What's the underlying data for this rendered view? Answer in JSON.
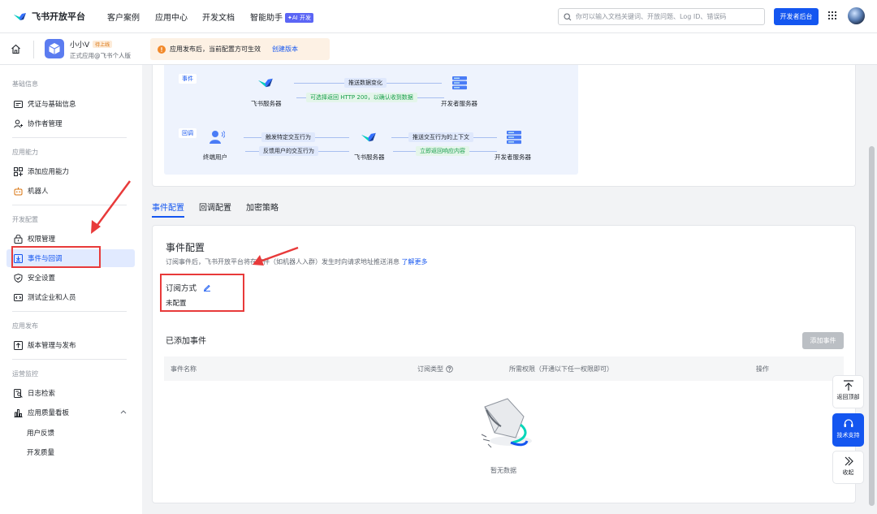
{
  "topnav": {
    "logo_text": "飞书开放平台",
    "links": [
      "客户案例",
      "应用中心",
      "开发文档",
      "智能助手"
    ],
    "ai_badge": "✦AI 开发",
    "search_placeholder": "你可以输入文档关键词、开放问题、Log ID、错误码",
    "dev_console_label": "开发者后台"
  },
  "appbar": {
    "app_name": "小小V",
    "status_badge": "待上线",
    "app_subtitle": "正式应用@飞书个人版",
    "notice_text": "应用发布后，当前配置方可生效",
    "notice_link": "创建版本"
  },
  "sidebar": {
    "groups": [
      {
        "title": "基础信息",
        "items": [
          "凭证与基础信息",
          "协作者管理"
        ]
      },
      {
        "title": "应用能力",
        "items": [
          "添加应用能力",
          "机器人"
        ]
      },
      {
        "title": "开发配置",
        "items": [
          "权限管理",
          "事件与回调",
          "安全设置",
          "测试企业和人员"
        ]
      },
      {
        "title": "应用发布",
        "items": [
          "版本管理与发布"
        ]
      },
      {
        "title": "运营监控",
        "items": [
          "日志检索",
          "应用质量看板"
        ]
      }
    ],
    "quality_sub_items": [
      "用户反馈",
      "开发质量"
    ],
    "active_item": "事件与回调"
  },
  "flow": {
    "event_tag": "事件",
    "callback_tag": "回调",
    "event_row": {
      "left_node": "飞书服务器",
      "right_node": "开发者服务器",
      "forward_label": "推送数据变化",
      "back_label": "可选择返回 HTTP 200，以确认收到数据"
    },
    "callback_row": {
      "node1": "终端用户",
      "node2": "飞书服务器",
      "node3": "开发者服务器",
      "forward1": "触发特定交互行为",
      "back1": "反馈用户的交互行为",
      "forward2": "推送交互行为的上下文",
      "back2": "立即返回响应内容"
    }
  },
  "tabs": [
    "事件配置",
    "回调配置",
    "加密策略"
  ],
  "event_config": {
    "title": "事件配置",
    "description": "订阅事件后，飞书开放平台将在事件（如机器人入群）发生时向请求地址推送消息",
    "learn_more": "了解更多",
    "subscription_label": "订阅方式",
    "subscription_value": "未配置",
    "added_events_title": "已添加事件",
    "add_event_button": "添加事件",
    "table_headers": [
      "事件名称",
      "订阅类型",
      "所需权限（开通以下任一权限即可）",
      "操作"
    ],
    "empty_text": "暂无数据"
  },
  "float_buttons": [
    "返回顶部",
    "技术支持",
    "收起"
  ],
  "colors": {
    "accent": "#1456f0",
    "annotation_red": "#e83a3a",
    "active_bg": "#e1eaff"
  }
}
